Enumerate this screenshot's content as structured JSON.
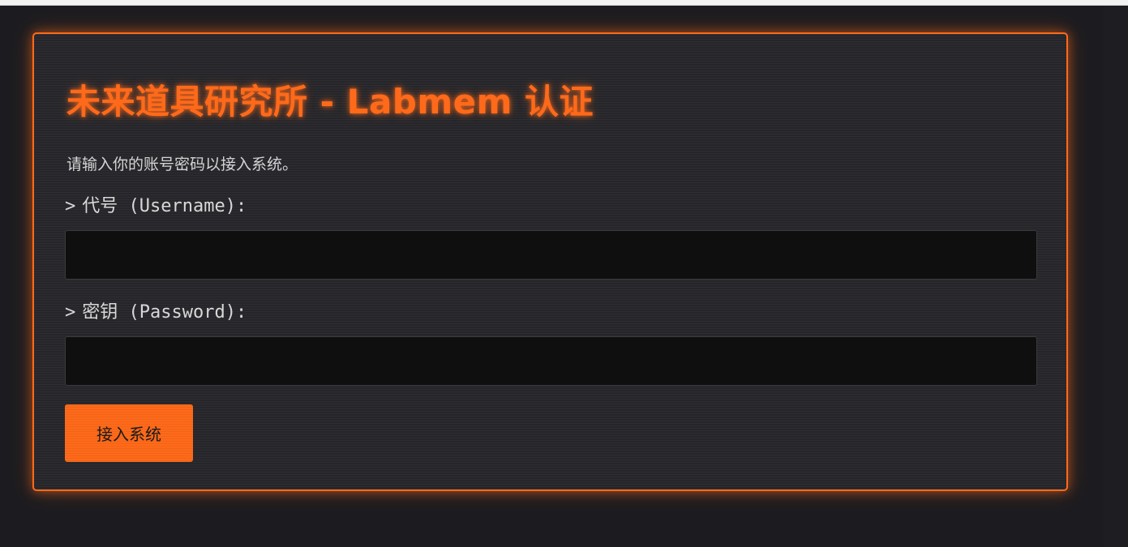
{
  "login": {
    "title": "未来道具研究所 - Labmem 认证",
    "intro": "请输入你的账号密码以接入系统。",
    "prompt_symbol": ">",
    "username_label": "代号 (Username):",
    "username_value": "",
    "password_label": "密钥 (Password):",
    "password_value": "",
    "submit_label": "接入系统"
  },
  "colors": {
    "accent": "#ff6a1a",
    "background": "#1c1c20",
    "panel": "#26262a",
    "input": "#0f0f10",
    "text": "#d8d8d8"
  }
}
